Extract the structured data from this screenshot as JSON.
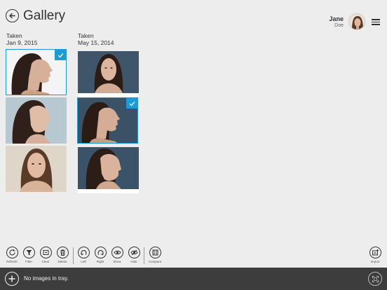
{
  "header": {
    "title": "Gallery",
    "user_first": "Jane",
    "user_last": "Doe"
  },
  "columns": [
    {
      "label": "Taken",
      "date": "Jan 9, 2015"
    },
    {
      "label": "Taken",
      "date": "May 15, 2014"
    }
  ],
  "photos": [
    {
      "id": "c1r1",
      "view": "profile-right",
      "background": "#f4f4f4",
      "selected": true
    },
    {
      "id": "c1r2",
      "view": "three-quarter-right",
      "background": "#b8c8d0",
      "selected": false
    },
    {
      "id": "c1r3",
      "view": "front",
      "background": "#ded6c8",
      "selected": false
    },
    {
      "id": "c2r1",
      "view": "front",
      "background": "#3f5569",
      "selected": false
    },
    {
      "id": "c2r2",
      "view": "profile-right",
      "background": "#3a5166",
      "selected": true
    },
    {
      "id": "c2r3",
      "view": "three-quarter-right",
      "background": "#3b5368",
      "selected": false
    }
  ],
  "toolbar": {
    "refresh": "Refresh",
    "filter": "Filter",
    "clear": "Clear",
    "delete": "Delete",
    "left": "Left",
    "right": "Right",
    "show": "Show",
    "hide": "Hide",
    "compare": "Compare",
    "import": "Import"
  },
  "footer": {
    "tray_text": "No images in tray."
  },
  "colors": {
    "accent": "#1a9ad6",
    "footer_bg": "#3d3d3d",
    "page_bg": "#ededed"
  }
}
